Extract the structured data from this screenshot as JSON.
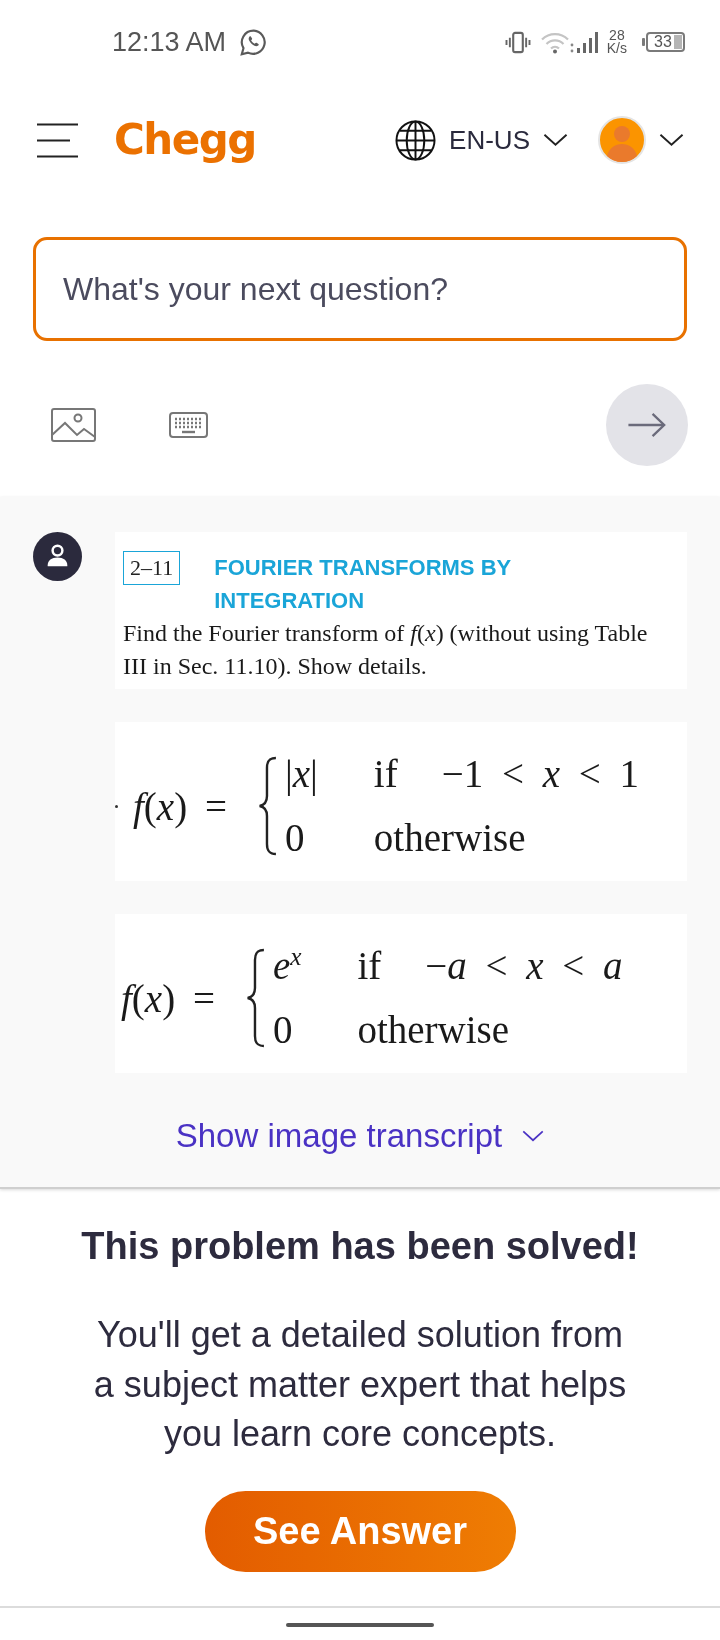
{
  "status_bar": {
    "time": "12:13 AM",
    "speed_value": "28",
    "speed_unit": "K/s",
    "battery": "33"
  },
  "header": {
    "logo": "Chegg",
    "language": "EN-US"
  },
  "search": {
    "placeholder": "What's your next question?"
  },
  "question": {
    "problem_number": "2–11",
    "title": "FOURIER TRANSFORMS BY INTEGRATION",
    "text": "Find the Fourier transform of *f*(*x*) (without using Table III in Sec. 11.10). Show details.",
    "formulas": [
      {
        "lead_dot": true,
        "lhs": "*f*(*x*) =",
        "cases": [
          {
            "value": "|*x*|",
            "condition": [
              "if",
              "−1 < *x* < 1"
            ]
          },
          {
            "value": "0",
            "condition": [
              "otherwise"
            ]
          }
        ]
      },
      {
        "lead_dot": false,
        "lhs": "*f*(*x*) =",
        "cases": [
          {
            "value": "*e*$^{x}$",
            "condition": [
              "if",
              "−*a* < *x* < *a*"
            ]
          },
          {
            "value": "0",
            "condition": [
              "otherwise"
            ]
          }
        ]
      }
    ]
  },
  "transcript_link": "Show image transcript",
  "solution": {
    "title": "This problem has been solved!",
    "text": "You'll get a detailed solution from a subject matter expert that helps you learn core concepts.",
    "button": "See Answer"
  }
}
